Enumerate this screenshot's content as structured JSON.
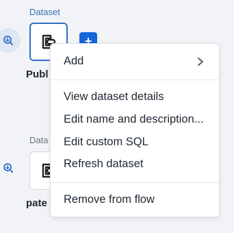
{
  "canvas": {
    "node1": {
      "section_label": "Dataset",
      "name": "Publ",
      "plus_label": "+"
    },
    "node2": {
      "section_label": "Data",
      "name": "pate"
    }
  },
  "context_menu": {
    "add_label": "Add",
    "view_details": "View dataset details",
    "edit_name": "Edit name and description...",
    "edit_sql": "Edit custom SQL",
    "refresh": "Refresh dataset",
    "remove": "Remove from flow"
  },
  "icons": {
    "zoom": "zoom-in-icon",
    "dataset": "dataset-icon",
    "chevron": "chevron-right-icon"
  },
  "colors": {
    "accent": "#2f6ec5",
    "plus_button": "#1266d6",
    "zoom_bg": "#dde6f3"
  }
}
